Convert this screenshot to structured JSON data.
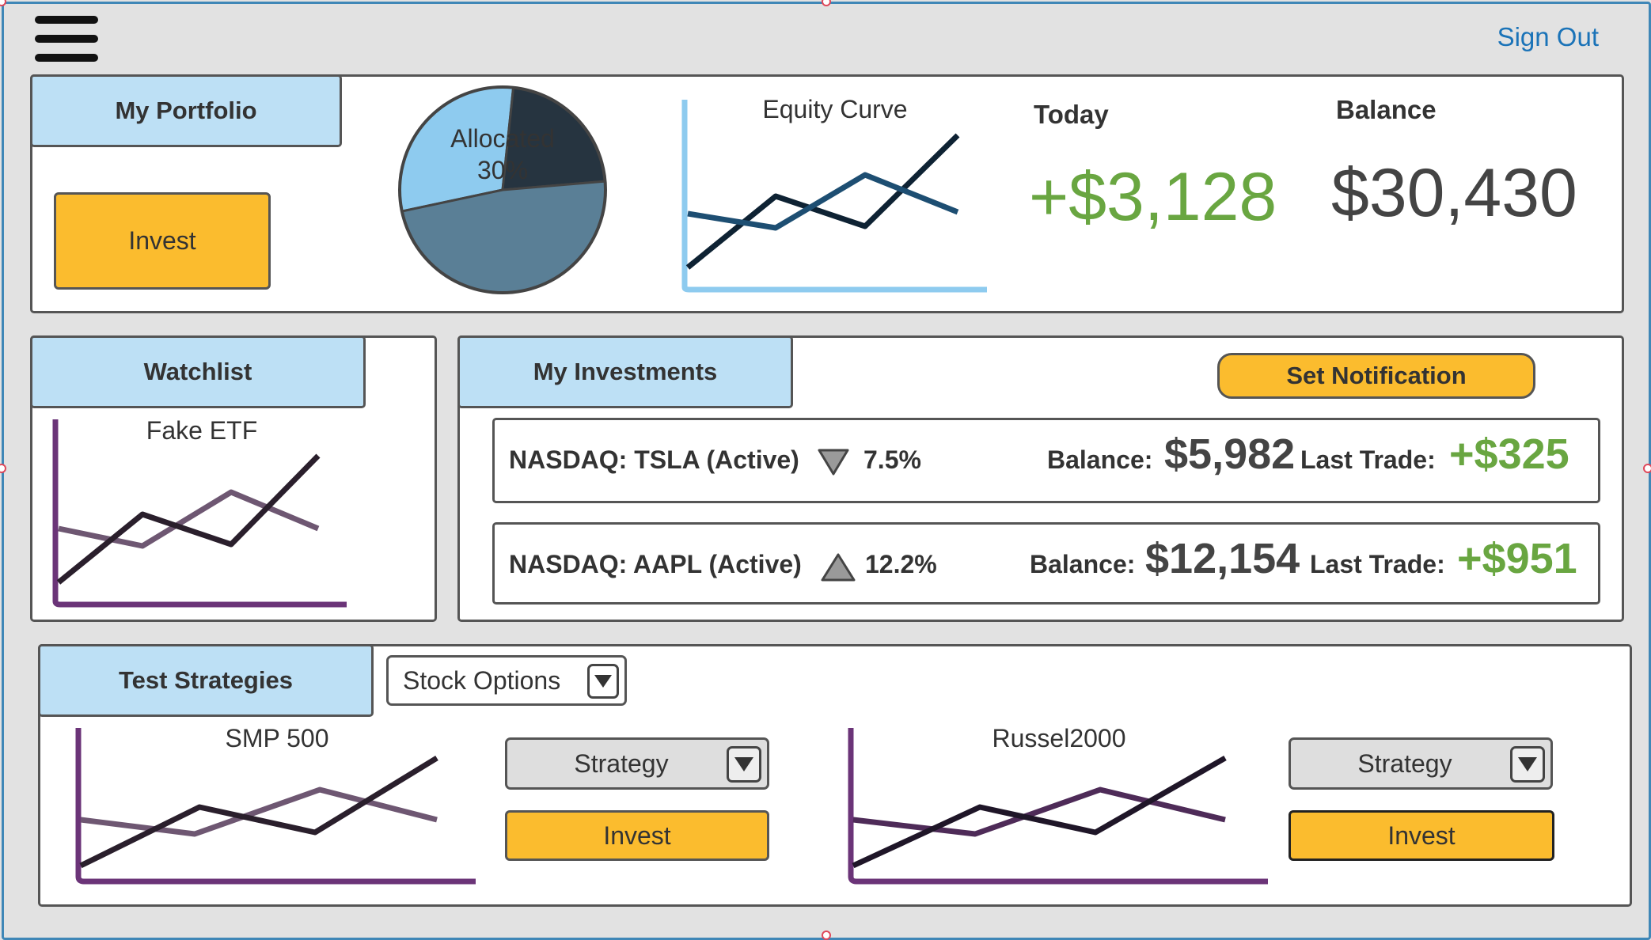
{
  "header": {
    "menu_icon": "hamburger-menu-icon",
    "sign_out_label": "Sign Out",
    "link_color": "#1a73b8"
  },
  "portfolio": {
    "tab_label": "My Portfolio",
    "invest_label": "Invest",
    "pie": {
      "label_line1": "Allocated",
      "label_line2": "30%",
      "slices": [
        {
          "name": "Allocated",
          "value": 30,
          "color": "#8ecbef"
        },
        {
          "name": "",
          "value": 22,
          "color": "#263440"
        },
        {
          "name": "",
          "value": 48,
          "color": "#5a7f96"
        }
      ]
    },
    "equity_curve": {
      "title": "Equity Curve"
    },
    "today": {
      "label": "Today",
      "value": "+$3,128",
      "color": "#69a641"
    },
    "balance": {
      "label": "Balance",
      "value": "$30,430",
      "color": "#444444"
    }
  },
  "watchlist": {
    "tab_label": "Watchlist",
    "chart_title": "Fake ETF"
  },
  "investments": {
    "tab_label": "My Investments",
    "notification_label": "Set Notification",
    "rows": [
      {
        "ticker": "NASDAQ: TSLA (Active)",
        "direction_icon": "triangle-down-icon",
        "change": "7.5%",
        "balance_label": "Balance:",
        "balance": "$5,982",
        "last_trade_label": "Last Trade:",
        "last_trade": "+$325"
      },
      {
        "ticker": "NASDAQ: AAPL (Active)",
        "direction_icon": "triangle-up-icon",
        "change": "12.2%",
        "balance_label": "Balance:",
        "balance": "$12,154",
        "last_trade_label": "Last Trade:",
        "last_trade": "+$951"
      }
    ]
  },
  "strategies": {
    "tab_label": "Test Strategies",
    "dropdown_value": "Stock Options",
    "panels": [
      {
        "chart_title": "SMP 500",
        "strategy_value": "Strategy",
        "invest_label": "Invest"
      },
      {
        "chart_title": "Russel2000",
        "strategy_value": "Strategy",
        "invest_label": "Invest"
      }
    ]
  },
  "colors": {
    "tab_bg": "#bde0f5",
    "accent_orange": "#fbbc2e",
    "positive_green": "#69a641",
    "axis_blue": "#8ecbef",
    "axis_purple": "#6b3478"
  }
}
